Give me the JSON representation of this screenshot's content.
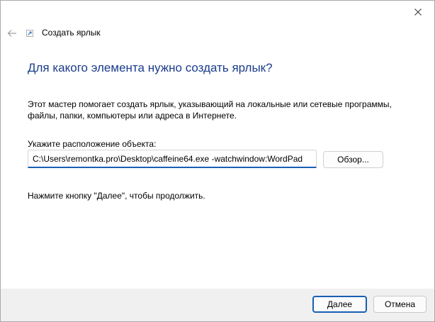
{
  "window": {
    "close_icon": "close-icon"
  },
  "header": {
    "back_icon": "arrow-left-icon",
    "wizard_icon": "shortcut-icon",
    "title": "Создать ярлык"
  },
  "main": {
    "heading": "Для какого элемента нужно создать ярлык?",
    "description": "Этот мастер помогает создать ярлык, указывающий на локальные или сетевые программы, файлы, папки, компьютеры или адреса в Интернете.",
    "location_label": "Укажите расположение объекта:",
    "location_value": "C:\\Users\\remontka.pro\\Desktop\\caffeine64.exe -watchwindow:WordPad",
    "browse_label": "Обзор...",
    "hint": "Нажмите кнопку \"Далее\", чтобы продолжить."
  },
  "footer": {
    "next_label": "Далее",
    "cancel_label": "Отмена"
  },
  "colors": {
    "accent": "#1a5fb4",
    "heading": "#1a3c8c",
    "footer_bg": "#f0f0f0"
  }
}
